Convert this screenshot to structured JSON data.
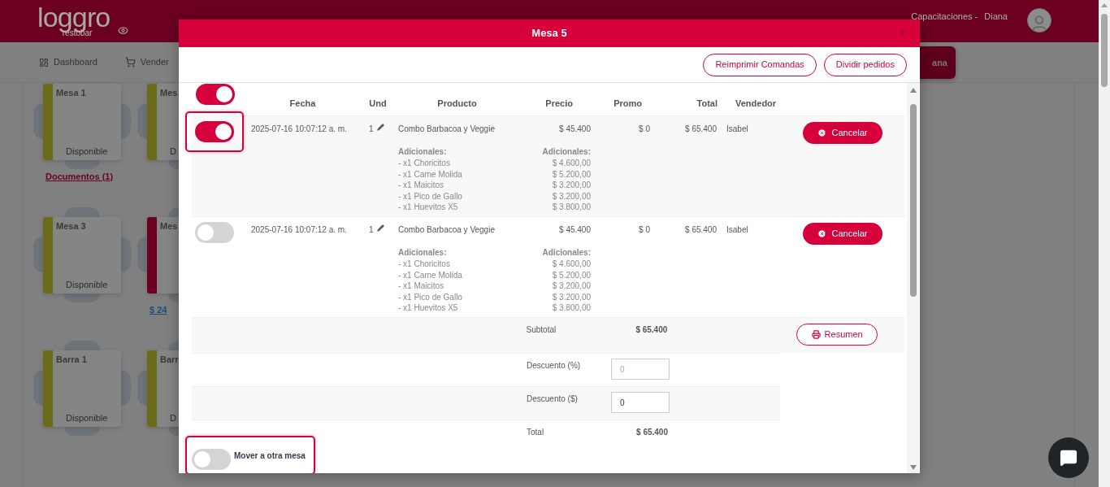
{
  "header": {
    "logo": {
      "name": "loggro",
      "tagline": "restobar"
    },
    "company": "Capacitaciones -",
    "user": "Diana"
  },
  "nav": [
    {
      "label": "Dashboard"
    },
    {
      "label": "Vender"
    }
  ],
  "background_button": "ana",
  "tables": [
    [
      {
        "name": "Mesa 1",
        "status": "Disponible",
        "color": "#6b6b1a",
        "link": "Documentos (1)"
      },
      {
        "name": "Mesa 3",
        "status": "Disponible",
        "color": "#6b6b1a"
      },
      {
        "name": "Barra 1",
        "status": "Disponible",
        "color": "#6b6b1a"
      }
    ],
    [
      {
        "name": "Mes",
        "status": "D",
        "color": "#6b6b1a"
      },
      {
        "name": "Mes",
        "color": "#6b0020",
        "link": "$ 24"
      },
      {
        "name": "Barr",
        "status": "D",
        "color": "#6b6b1a"
      }
    ]
  ],
  "modal": {
    "title": "Mesa 5",
    "close": "×",
    "actions": [
      "Reimprimir Comandas",
      "Dividir pedidos"
    ],
    "select_all": {
      "on": true
    },
    "columns": [
      "Fecha",
      "Und",
      "Producto",
      "Precio",
      "Promo",
      "Total",
      "Vendedor"
    ],
    "rows": [
      {
        "on": true,
        "highlighted": true,
        "date": "2025-07-16 10:07:12 a. m.",
        "qty": "1",
        "product": "Combo Barbacoa y Veggie",
        "price": "$ 45.400",
        "promo": "$ 0",
        "total": "$ 65.400",
        "seller": "Isabel",
        "extras_label": "Adicionales:",
        "extras": [
          {
            "name": "- x1 Choricitos",
            "price": "$ 4.600,00"
          },
          {
            "name": "- x1 Carne Molida",
            "price": "$ 5.200,00"
          },
          {
            "name": "- x1 Maicitos",
            "price": "$ 3.200,00"
          },
          {
            "name": "- x1 Pico de Gallo",
            "price": "$ 3.200,00"
          },
          {
            "name": "- x1 Huevitos X5",
            "price": "$ 3.800,00"
          }
        ],
        "price_extras_label": "Adicionales:",
        "action": "Cancelar"
      },
      {
        "on": false,
        "highlighted": false,
        "date": "2025-07-16 10:07:12 a. m.",
        "qty": "1",
        "product": "Combo Barbacoa y Veggie",
        "price": "$ 45.400",
        "promo": "$ 0",
        "total": "$ 65.400",
        "seller": "Isabel",
        "extras_label": "Adicionales:",
        "extras": [
          {
            "name": "- x1 Choricitos",
            "price": "$ 4.600,00"
          },
          {
            "name": "- x1 Carne Molida",
            "price": "$ 5.200,00"
          },
          {
            "name": "- x1 Maicitos",
            "price": "$ 3.200,00"
          },
          {
            "name": "- x1 Pico de Gallo",
            "price": "$ 3.200,00"
          },
          {
            "name": "- x1 Huevitos X5",
            "price": "$ 3.800,00"
          }
        ],
        "price_extras_label": "Adicionales:",
        "action": "Cancelar"
      }
    ],
    "summary": {
      "subtotal": {
        "label": "Subtotal",
        "value": "$ 65.400"
      },
      "summary_button": "Resumen",
      "discount_percent": {
        "label": "Descuento (%)",
        "placeholder": "0"
      },
      "discount_amount": {
        "label": "Descuento ($)",
        "value": "0"
      },
      "total": {
        "label": "Total",
        "value": "$ 65.400"
      }
    },
    "move": {
      "label": "Mover a otra mesa",
      "on": false,
      "highlighted": true
    }
  }
}
